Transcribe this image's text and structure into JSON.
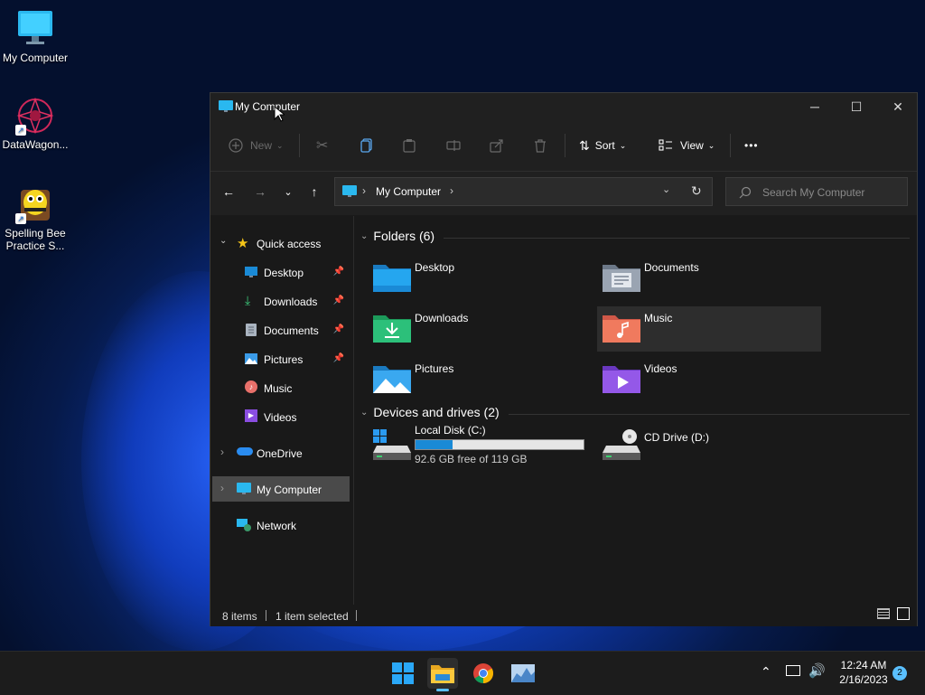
{
  "desktop": {
    "icons": [
      {
        "label": "My Computer"
      },
      {
        "label": "DataWagon..."
      },
      {
        "label": "Spelling Bee Practice S..."
      }
    ]
  },
  "window": {
    "title": "My Computer",
    "controls": {
      "minimize": "─",
      "maximize": "☐",
      "close": "✕"
    }
  },
  "toolbar": {
    "new_label": "New",
    "sort_label": "Sort",
    "view_label": "View",
    "more_label": "•••"
  },
  "address": {
    "crumb": "My Computer",
    "search_placeholder": "Search My Computer"
  },
  "sidebar": {
    "items": [
      {
        "label": "Quick access"
      },
      {
        "label": "Desktop"
      },
      {
        "label": "Downloads"
      },
      {
        "label": "Documents"
      },
      {
        "label": "Pictures"
      },
      {
        "label": "Music"
      },
      {
        "label": "Videos"
      },
      {
        "label": "OneDrive"
      },
      {
        "label": "My Computer"
      },
      {
        "label": "Network"
      }
    ]
  },
  "folders": {
    "header": "Folders (6)",
    "items": [
      {
        "label": "Desktop"
      },
      {
        "label": "Documents"
      },
      {
        "label": "Downloads"
      },
      {
        "label": "Music"
      },
      {
        "label": "Pictures"
      },
      {
        "label": "Videos"
      }
    ]
  },
  "drives": {
    "header": "Devices and drives (2)",
    "items": [
      {
        "label": "Local Disk (C:)",
        "free_text": "92.6 GB free of 119 GB",
        "used_fraction": 0.22
      },
      {
        "label": "CD Drive (D:)"
      }
    ]
  },
  "status": {
    "items_count": "8 items",
    "selected": "1 item selected"
  },
  "taskbar": {
    "time": "12:24 AM",
    "date": "2/16/2023",
    "notifications": "2"
  },
  "colors": {
    "accent": "#1a8ad6",
    "selection": "#4a4a4a"
  }
}
